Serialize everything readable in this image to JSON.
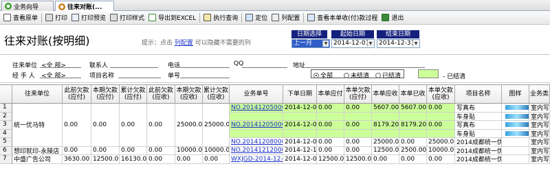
{
  "tabs": [
    {
      "label": "业务向导",
      "active": false
    },
    {
      "label": "往来对账(...",
      "active": true
    }
  ],
  "toolbar": [
    {
      "name": "view-source-button",
      "label": "查看原单"
    },
    {
      "name": "print-button",
      "label": "打印"
    },
    {
      "name": "print-preview-button",
      "label": "打印预览"
    },
    {
      "name": "print-style-button",
      "label": "打印样式"
    },
    {
      "name": "export-excel-button",
      "label": "导出到EXCEL"
    },
    {
      "name": "run-query-button",
      "label": "执行查询"
    },
    {
      "name": "locate-button",
      "label": "定位"
    },
    {
      "name": "column-config-button",
      "label": "列配置"
    },
    {
      "name": "view-receipt-process-button",
      "label": "查看本单收(付)款过程"
    },
    {
      "name": "exit-button",
      "label": "退出"
    }
  ],
  "page": {
    "title": "往来对账(按明细)",
    "hint_prefix": "提示：点击",
    "hint_link": "列配置",
    "hint_suffix": "可以隐藏不需要的列"
  },
  "dates": {
    "select_label": "日期选择",
    "select_value": "上一月",
    "start_label": "起始日期",
    "start_value": "2014-12-01",
    "end_label": "结束日期",
    "end_value": "2014-12-31"
  },
  "filters": {
    "unit_label": "往来单位",
    "unit_value": "<全 部>",
    "contact_label": "联系人",
    "phone_label": "电话",
    "qq_label": "QQ",
    "address_label": "地址",
    "handler_label": "经 手 人",
    "handler_value": "<全 部>",
    "project_label": "项目名称",
    "doc_label": "单号",
    "radio_all": "全部",
    "radio_unsettled": "未结清",
    "radio_settled": "已结清",
    "legend_settled": "- 已结清"
  },
  "grid": {
    "headers": [
      "往来单位",
      "此前欠款\n(应付)",
      "本期欠款\n(应付)",
      "累计欠款\n(应付)",
      "此前欠款\n(应收)",
      "本期欠款\n(应收)",
      "累计欠款\n(应收)",
      "业务单号",
      "下单日期",
      "本单应付",
      "本单欠款\n(应付)",
      "本单应收",
      "本单已收",
      "本单欠款\n(应收)",
      "项目名称",
      "图样",
      "业务类"
    ],
    "unit_groups": [
      {
        "unit": "统一优马特",
        "prev_pay": "0.00",
        "cur_pay": "0.00",
        "cum_pay": "0.00",
        "prev_rec": "0.00",
        "cur_rec": "25000.00",
        "cum_rec": "25000.00"
      },
      {
        "unit": "想印就印-永陵店",
        "prev_pay": "0.00",
        "cur_pay": "0.00",
        "cum_pay": "0.00",
        "prev_rec": "0.00",
        "cur_rec": "10000.00",
        "cum_rec": "10000.00"
      },
      {
        "unit": "中盛广告公司",
        "prev_pay": "3630.00",
        "cur_pay": "12500.00",
        "cum_pay": "16130.00",
        "prev_rec": "0.00",
        "cur_rec": "0.00",
        "cum_rec": "0.00"
      }
    ],
    "rows": [
      {
        "n": "1",
        "doc": "NO.201412050001",
        "date": "2014-12-05",
        "pay": "0.00",
        "pay_owe": "0.00",
        "rec": "5607.00",
        "recd": "5607.00",
        "rec_owe": "0.00",
        "project": "写真布",
        "pattern": true,
        "biz": "室内写",
        "green": true
      },
      {
        "n": "2",
        "doc": "",
        "date": "",
        "pay": "",
        "pay_owe": "",
        "rec": "",
        "recd": "",
        "rec_owe": "",
        "project": "车身贴",
        "pattern": true,
        "biz": "室内写",
        "green": true
      },
      {
        "n": "3",
        "doc": "NO.201412050002",
        "date": "2014-12-05",
        "pay": "0.00",
        "pay_owe": "0.00",
        "rec": "8179.20",
        "recd": "8179.20",
        "rec_owe": "0.00",
        "project": "写真布",
        "pattern": true,
        "biz": "室内写",
        "green": true
      },
      {
        "n": "4",
        "doc": "",
        "date": "",
        "pay": "",
        "pay_owe": "",
        "rec": "",
        "recd": "",
        "rec_owe": "",
        "project": "车身贴",
        "pattern": true,
        "biz": "室内写",
        "green": true
      },
      {
        "n": "5",
        "doc": "NO.201412080001",
        "date": "2014-12-08",
        "pay": "0.00",
        "pay_owe": "0.00",
        "rec": "25000.00",
        "recd": "0.00",
        "rec_owe": "25000.00",
        "project": "2014成都统一优",
        "pattern": false,
        "biz": "室内写",
        "green": false
      },
      {
        "n": "6",
        "doc": "NO.201412120001",
        "date": "2014-12-12",
        "pay": "0.00",
        "pay_owe": "0.00",
        "rec": "12500.00",
        "recd": "2500.00",
        "rec_owe": "10000.00",
        "project": "2014成都统一优",
        "pattern": false,
        "biz": "室内写",
        "green": false
      },
      {
        "n": "7",
        "doc": "WXJGD-2014-12-0",
        "date": "2014-12-08",
        "pay": "12500.00",
        "pay_owe": "12500.00",
        "rec": "0.00",
        "recd": "0.00",
        "rec_owe": "0.00",
        "project": "2014成都统一优",
        "pattern": false,
        "biz": "室内写",
        "green": false
      }
    ]
  }
}
